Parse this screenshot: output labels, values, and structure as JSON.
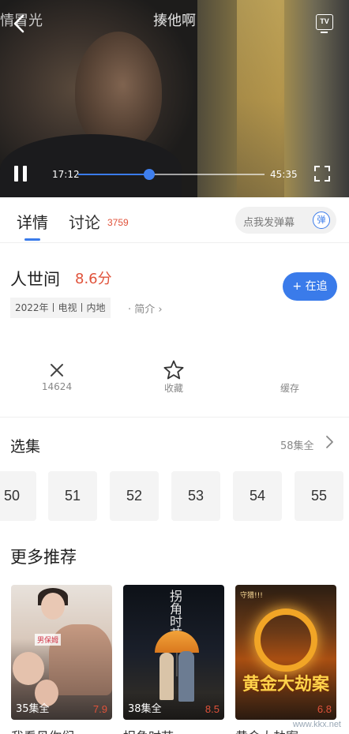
{
  "player": {
    "prev_title": "情冒光",
    "title": "揍他啊",
    "tv_label": "TV",
    "time_current": "17:12",
    "time_total": "45:35",
    "progress_fraction": 0.38
  },
  "tabs": {
    "detail_label": "详情",
    "discuss_label": "讨论",
    "discuss_count": "3759",
    "danmaku_placeholder": "点我发弹幕",
    "danmaku_icon_label": "弹"
  },
  "show": {
    "name": "人世间",
    "score": "8.6分",
    "meta": "2022年丨电视丨内地",
    "intro_label": "· 简介 ›",
    "follow_label": "+ 在追"
  },
  "actions": {
    "close_count": "14624",
    "favorite_label": "收藏",
    "cache_label": "缓存"
  },
  "episodes": {
    "heading": "选集",
    "total_label": "58集全",
    "items": [
      "50",
      "51",
      "52",
      "53",
      "54",
      "55"
    ]
  },
  "recommend": {
    "heading": "更多推荐",
    "items": [
      {
        "episodes": "35集全",
        "rating": "7.9",
        "title": "我看见你们"
      },
      {
        "episodes": "38集全",
        "rating": "8.5",
        "title": "拐角时节"
      },
      {
        "episodes": "",
        "rating": "6.8",
        "title": "黄金大劫案"
      }
    ],
    "poster_texts": {
      "p1_tag": "男保姆",
      "p2_title": "拐角时节",
      "p3_title": "黄金大劫案",
      "p3_top": "守猎!!!"
    }
  },
  "watermark": "www.kkx.net",
  "colors": {
    "accent_blue": "#3a7bea",
    "score_red": "#e0523a"
  }
}
